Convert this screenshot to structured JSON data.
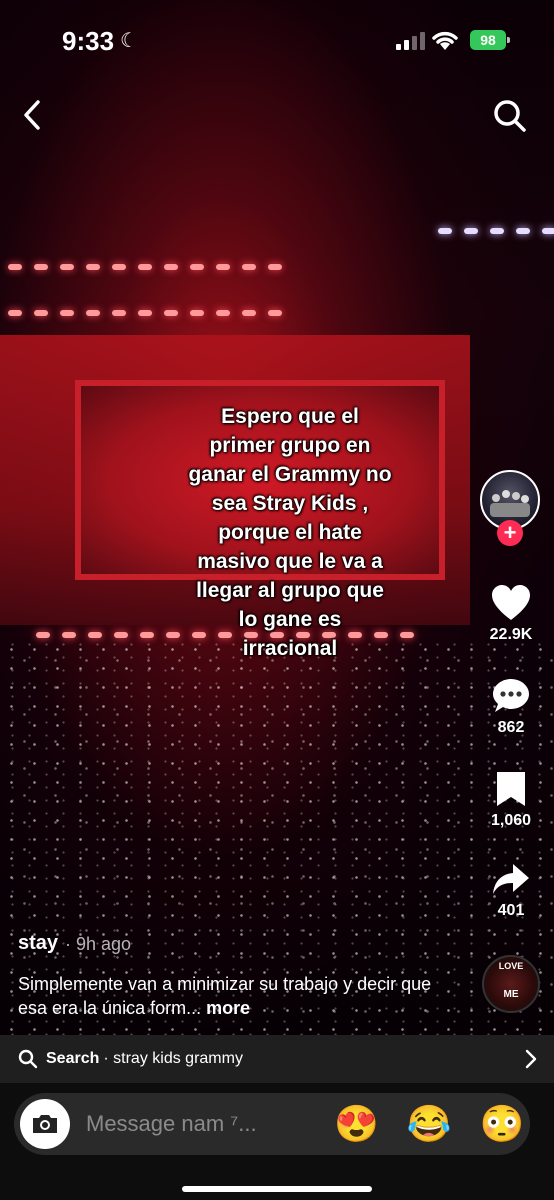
{
  "status_bar": {
    "time": "9:33",
    "battery": "98"
  },
  "video": {
    "caption_lines": [
      "Espero que el",
      "primer grupo en",
      "ganar el Grammy no",
      "sea Stray Kids ,",
      "porque el hate",
      "masivo que le va a",
      "llegar al grupo que",
      "lo gane es",
      "irracional"
    ]
  },
  "actions": {
    "likes": "22.9K",
    "comments": "862",
    "saves": "1,060",
    "shares": "401"
  },
  "music_disc": {
    "line1": "LOVE",
    "line2": "ME"
  },
  "post": {
    "username": "stay",
    "time_ago": "· 9h ago",
    "description": "Simplemente van a minimizar su trabajo y decir que esa era la única form...",
    "more_label": " more"
  },
  "search": {
    "label": "Search",
    "query": "· stray kids grammy"
  },
  "message": {
    "placeholder": "Message nam ⁷..."
  },
  "emojis": [
    "😍",
    "😂",
    "😳"
  ],
  "colors": {
    "accent": "#fe2c55",
    "battery": "#34c759"
  }
}
